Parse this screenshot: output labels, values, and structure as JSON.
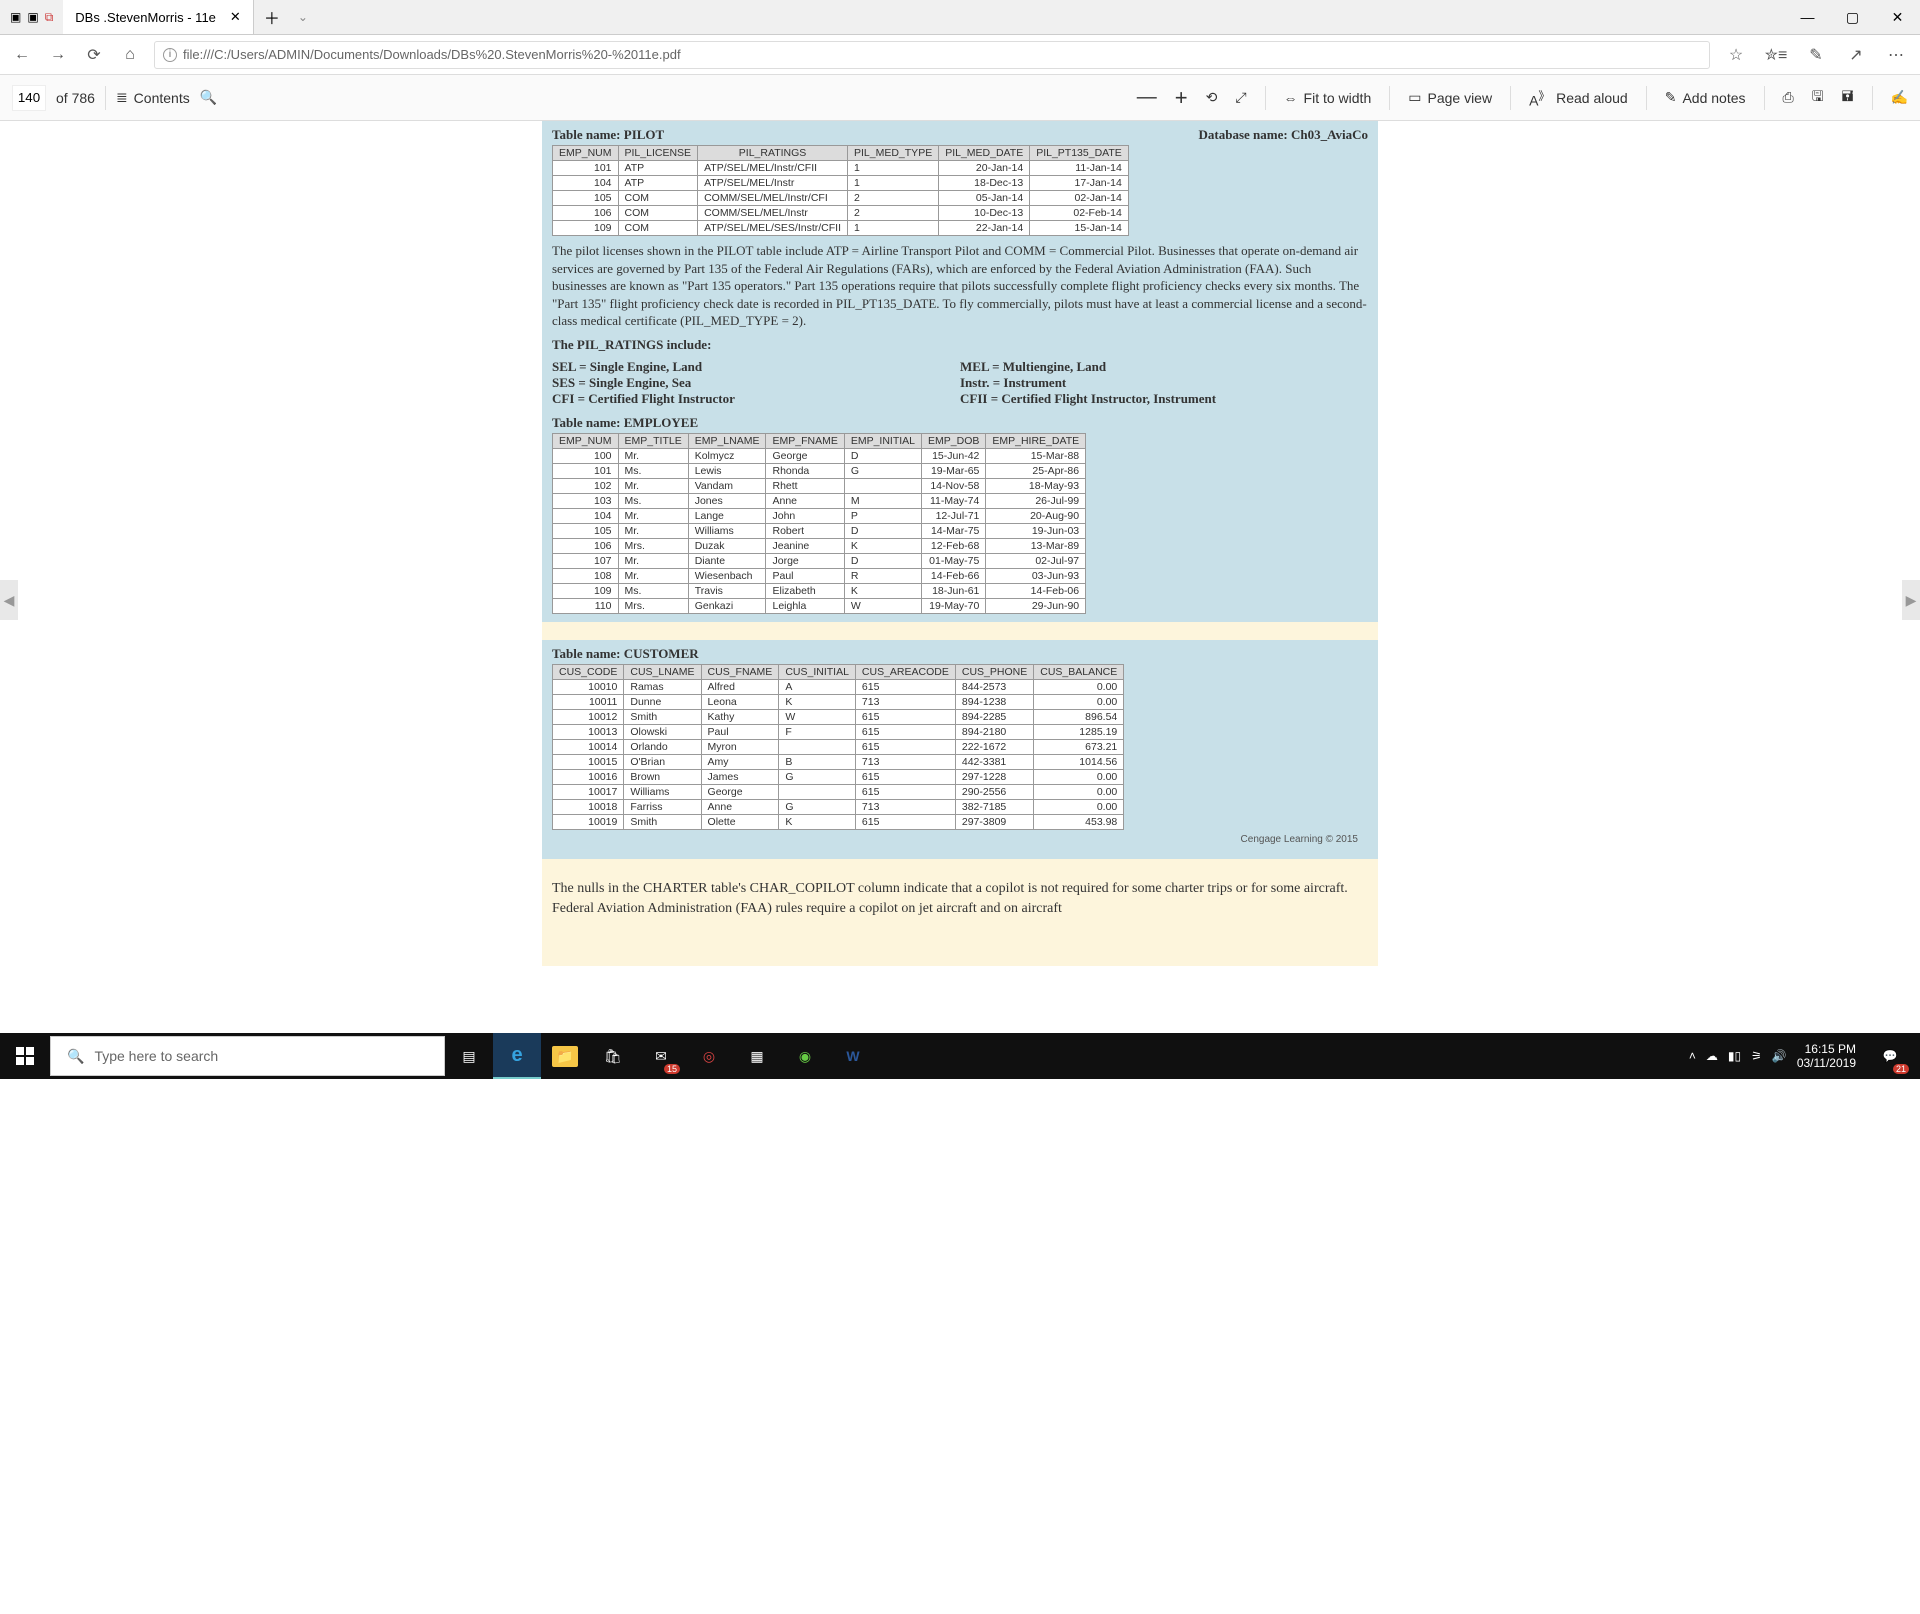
{
  "window": {
    "tab_title": "DBs .StevenMorris - 11e",
    "address": "file:///C:/Users/ADMIN/Documents/Downloads/DBs%20.StevenMorris%20-%2011e.pdf"
  },
  "pdfbar": {
    "page_current": "140",
    "page_of": "of 786",
    "contents": "Contents",
    "fit": "Fit to width",
    "pageview": "Page view",
    "readaloud": "Read aloud",
    "addnotes": "Add notes"
  },
  "doc": {
    "pilot": {
      "title": "Table name: PILOT",
      "dbname": "Database name: Ch03_AviaCo",
      "headers": [
        "EMP_NUM",
        "PIL_LICENSE",
        "PIL_RATINGS",
        "PIL_MED_TYPE",
        "PIL_MED_DATE",
        "PIL_PT135_DATE"
      ],
      "rows": [
        [
          "101",
          "ATP",
          "ATP/SEL/MEL/Instr/CFII",
          "1",
          "20-Jan-14",
          "11-Jan-14"
        ],
        [
          "104",
          "ATP",
          "ATP/SEL/MEL/Instr",
          "1",
          "18-Dec-13",
          "17-Jan-14"
        ],
        [
          "105",
          "COM",
          "COMM/SEL/MEL/Instr/CFI",
          "2",
          "05-Jan-14",
          "02-Jan-14"
        ],
        [
          "106",
          "COM",
          "COMM/SEL/MEL/Instr",
          "2",
          "10-Dec-13",
          "02-Feb-14"
        ],
        [
          "109",
          "COM",
          "ATP/SEL/MEL/SES/Instr/CFII",
          "1",
          "22-Jan-14",
          "15-Jan-14"
        ]
      ]
    },
    "pilot_para": "The pilot licenses shown in the PILOT table include ATP = Airline Transport Pilot and COMM = Commercial Pilot. Businesses that operate on-demand air services are governed by Part 135 of the Federal Air Regulations (FARs), which are enforced by the Federal Aviation Administration (FAA). Such businesses are known as \"Part 135 operators.\" Part 135 operations require that pilots successfully complete flight proficiency checks every six months. The \"Part 135\" flight proficiency check date is recorded in PIL_PT135_DATE. To fly commercially, pilots must have at least a commercial license and a second-class medical certificate (PIL_MED_TYPE = 2).",
    "ratings_title": "The PIL_RATINGS include:",
    "ratings_left": [
      "SEL = Single Engine, Land",
      "SES = Single Engine, Sea",
      "CFI = Certified Flight Instructor"
    ],
    "ratings_right": [
      "MEL = Multiengine, Land",
      "Instr. = Instrument",
      "CFII  = Certified Flight Instructor, Instrument"
    ],
    "employee": {
      "title": "Table name: EMPLOYEE",
      "headers": [
        "EMP_NUM",
        "EMP_TITLE",
        "EMP_LNAME",
        "EMP_FNAME",
        "EMP_INITIAL",
        "EMP_DOB",
        "EMP_HIRE_DATE"
      ],
      "rows": [
        [
          "100",
          "Mr.",
          "Kolmycz",
          "George",
          "D",
          "15-Jun-42",
          "15-Mar-88"
        ],
        [
          "101",
          "Ms.",
          "Lewis",
          "Rhonda",
          "G",
          "19-Mar-65",
          "25-Apr-86"
        ],
        [
          "102",
          "Mr.",
          "Vandam",
          "Rhett",
          "",
          "14-Nov-58",
          "18-May-93"
        ],
        [
          "103",
          "Ms.",
          "Jones",
          "Anne",
          "M",
          "11-May-74",
          "26-Jul-99"
        ],
        [
          "104",
          "Mr.",
          "Lange",
          "John",
          "P",
          "12-Jul-71",
          "20-Aug-90"
        ],
        [
          "105",
          "Mr.",
          "Williams",
          "Robert",
          "D",
          "14-Mar-75",
          "19-Jun-03"
        ],
        [
          "106",
          "Mrs.",
          "Duzak",
          "Jeanine",
          "K",
          "12-Feb-68",
          "13-Mar-89"
        ],
        [
          "107",
          "Mr.",
          "Diante",
          "Jorge",
          "D",
          "01-May-75",
          "02-Jul-97"
        ],
        [
          "108",
          "Mr.",
          "Wiesenbach",
          "Paul",
          "R",
          "14-Feb-66",
          "03-Jun-93"
        ],
        [
          "109",
          "Ms.",
          "Travis",
          "Elizabeth",
          "K",
          "18-Jun-61",
          "14-Feb-06"
        ],
        [
          "110",
          "Mrs.",
          "Genkazi",
          "Leighla",
          "W",
          "19-May-70",
          "29-Jun-90"
        ]
      ]
    },
    "customer": {
      "title": "Table name: CUSTOMER",
      "headers": [
        "CUS_CODE",
        "CUS_LNAME",
        "CUS_FNAME",
        "CUS_INITIAL",
        "CUS_AREACODE",
        "CUS_PHONE",
        "CUS_BALANCE"
      ],
      "rows": [
        [
          "10010",
          "Ramas",
          "Alfred",
          "A",
          "615",
          "844-2573",
          "0.00"
        ],
        [
          "10011",
          "Dunne",
          "Leona",
          "K",
          "713",
          "894-1238",
          "0.00"
        ],
        [
          "10012",
          "Smith",
          "Kathy",
          "W",
          "615",
          "894-2285",
          "896.54"
        ],
        [
          "10013",
          "Olowski",
          "Paul",
          "F",
          "615",
          "894-2180",
          "1285.19"
        ],
        [
          "10014",
          "Orlando",
          "Myron",
          "",
          "615",
          "222-1672",
          "673.21"
        ],
        [
          "10015",
          "O'Brian",
          "Amy",
          "B",
          "713",
          "442-3381",
          "1014.56"
        ],
        [
          "10016",
          "Brown",
          "James",
          "G",
          "615",
          "297-1228",
          "0.00"
        ],
        [
          "10017",
          "Williams",
          "George",
          "",
          "615",
          "290-2556",
          "0.00"
        ],
        [
          "10018",
          "Farriss",
          "Anne",
          "G",
          "713",
          "382-7185",
          "0.00"
        ],
        [
          "10019",
          "Smith",
          "Olette",
          "K",
          "615",
          "297-3809",
          "453.98"
        ]
      ]
    },
    "copyright": "Cengage Learning © 2015",
    "footnote": "The nulls in the CHARTER table's CHAR_COPILOT column indicate that a copilot is not required for some charter trips or for some aircraft. Federal Aviation Administration (FAA) rules require a copilot on jet aircraft and on aircraft"
  },
  "taskbar": {
    "search_placeholder": "Type here to search",
    "time": "16:15 PM",
    "date": "03/11/2019",
    "badge15": "15",
    "badge21": "21"
  }
}
